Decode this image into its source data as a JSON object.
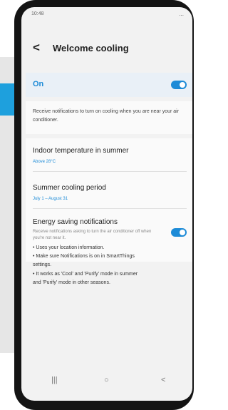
{
  "status_bar": {
    "time": "10:48",
    "icons": "..."
  },
  "header": {
    "back_icon": "<",
    "title": "Welcome cooling"
  },
  "master_toggle": {
    "label": "On",
    "state": true
  },
  "description": "Receive notifications to turn on cooling when you are near your air conditioner.",
  "settings": [
    {
      "title": "Indoor temperature in summer",
      "value": "Above 28°C"
    },
    {
      "title": "Summer cooling period",
      "value": "July 1 – August 31"
    }
  ],
  "energy_saving": {
    "title": "Energy saving notifications",
    "subtitle": "Receive notifications asking to turn the air conditioner off when you're not near it.",
    "state": true
  },
  "info_lines": [
    "• Uses your location information.",
    "• Make sure Notifications is on in SmartThings",
    "settings.",
    "• It works as 'Cool' and 'Purify' mode in summer",
    "and 'Purify' mode in other seasons."
  ],
  "nav_bar": {
    "recents": "|||",
    "home": "○",
    "back": "<"
  },
  "colors": {
    "accent": "#1d8bd7",
    "screen_background": "#f2f2f2",
    "side_panel": "#1ea0dd"
  }
}
